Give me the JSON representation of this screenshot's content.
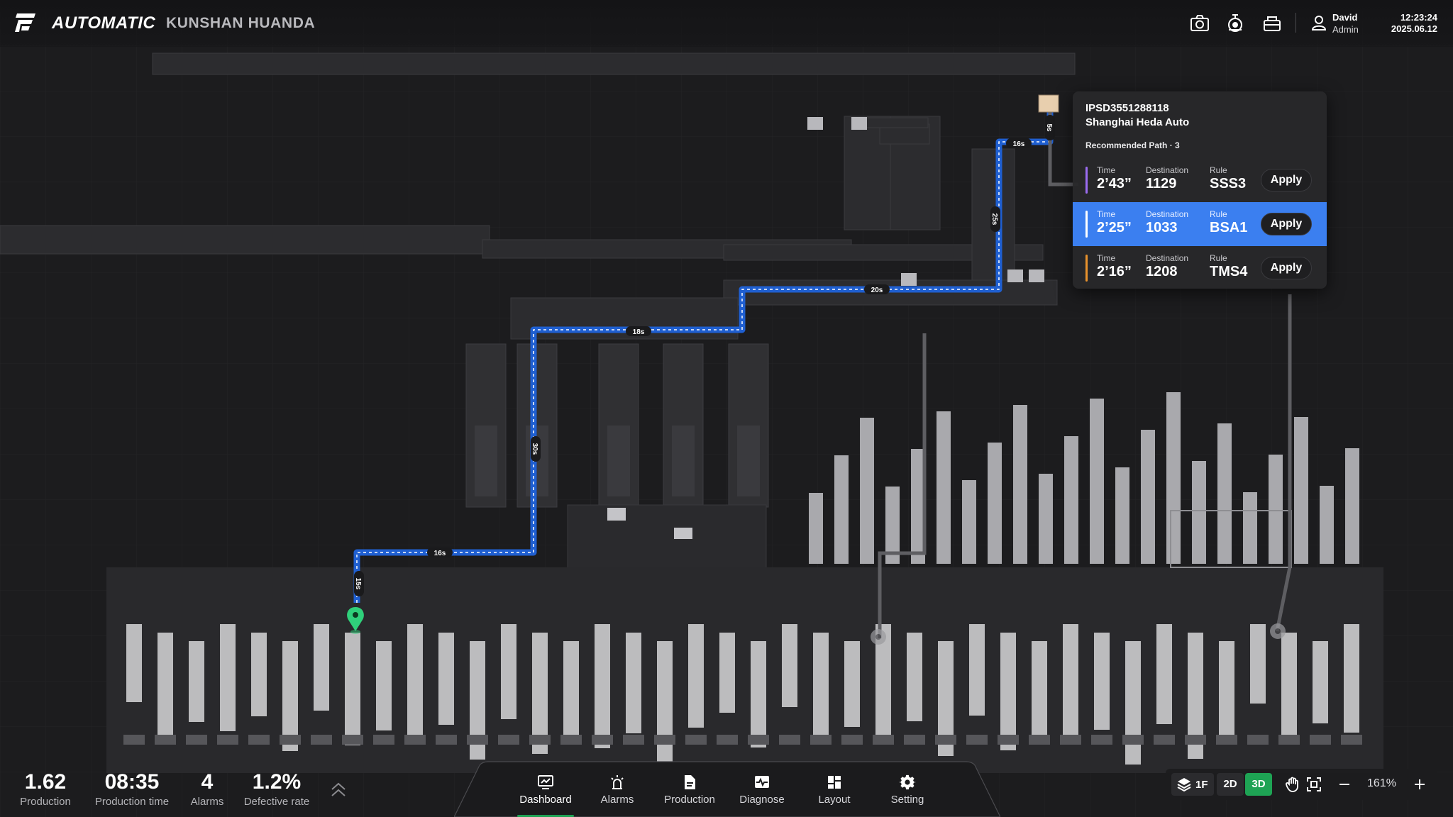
{
  "header": {
    "brand": "AUTOMATIC",
    "site": "KUNSHAN HUANDA",
    "icons": [
      "camera-icon",
      "robot-arm-icon",
      "basket-icon"
    ],
    "user": {
      "name": "David",
      "role": "Admin",
      "icon": "user-icon"
    },
    "clock": {
      "time": "12:23:24",
      "date": "2025.06.12"
    }
  },
  "path_labels": [
    "16s",
    "5s",
    "25s",
    "20s",
    "18s",
    "30s",
    "16s",
    "15s"
  ],
  "popup": {
    "id": "IPSD3551288118",
    "company": "Shanghai Heda Auto",
    "recommended": "Recommended Path · 3",
    "options": [
      {
        "time_label": "Time",
        "time": "2’43”",
        "dest_label": "Destination",
        "destination": "1129",
        "rule_label": "Rule",
        "rule": "SSS3",
        "button": "Apply",
        "color": "#9b6cf0",
        "selected": false
      },
      {
        "time_label": "Time",
        "time": "2’25”",
        "dest_label": "Destination",
        "destination": "1033",
        "rule_label": "Rule",
        "rule": "BSA1",
        "button": "Apply",
        "color": "#ffffff",
        "selected": true
      },
      {
        "time_label": "Time",
        "time": "2’16”",
        "dest_label": "Destination",
        "destination": "1208",
        "rule_label": "Rule",
        "rule": "TMS4",
        "button": "Apply",
        "color": "#e8922c",
        "selected": false
      }
    ]
  },
  "stats": [
    {
      "value": "1.62",
      "label": "Production"
    },
    {
      "value": "08:35",
      "label": "Production time"
    },
    {
      "value": "4",
      "label": "Alarms"
    },
    {
      "value": "1.2%",
      "label": "Defective rate"
    }
  ],
  "nav": {
    "items": [
      {
        "label": "Dashboard",
        "icon": "dashboard-icon",
        "active": true
      },
      {
        "label": "Alarms",
        "icon": "alarm-icon",
        "active": false
      },
      {
        "label": "Production",
        "icon": "document-icon",
        "active": false
      },
      {
        "label": "Diagnose",
        "icon": "pulse-icon",
        "active": false
      },
      {
        "label": "Layout",
        "icon": "layout-icon",
        "active": false
      },
      {
        "label": "Setting",
        "icon": "gear-icon",
        "active": false
      }
    ],
    "active_color": "#1ea354"
  },
  "controls": {
    "floor": "1F",
    "view_2d": "2D",
    "view_3d": "3D",
    "active_view": "3D",
    "zoom": "161%",
    "accent": "#1ea354"
  },
  "colors": {
    "path": "#2e86f5",
    "selected_row": "#3b7ff0",
    "marker": "#2fd07a"
  }
}
